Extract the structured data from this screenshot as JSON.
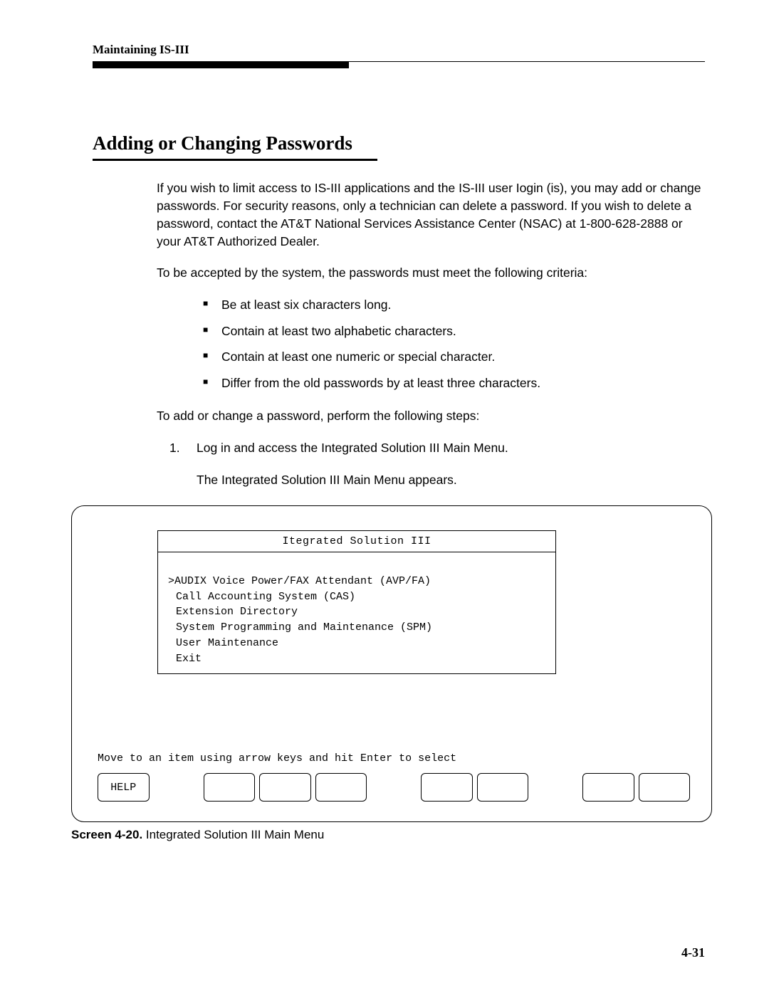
{
  "header": {
    "running_head": "Maintaining IS-III"
  },
  "section": {
    "title": "Adding or Changing Passwords",
    "para1": "If you wish to limit access to IS-III applications and the IS-III user Iogin (is), you may add or change passwords. For security reasons, only a technician can delete a password. If you wish to delete a password, contact the AT&T National Services Assistance Center (NSAC) at 1-800-628-2888 or your AT&T Authorized Dealer.",
    "para2": "To be accepted by the system, the passwords must meet the following criteria:",
    "bullets": [
      "Be at least six characters long.",
      "Contain at least two alphabetic characters.",
      "Contain at least one numeric or special character.",
      "Differ from the old passwords by at least three characters."
    ],
    "para3": "To add or change a password, perform the following steps:",
    "steps": [
      {
        "num": "1.",
        "text": "Log in and access the Integrated Solution III Main Menu."
      }
    ],
    "step_result": "The Integrated Solution III Main Menu appears."
  },
  "screen": {
    "menu_title": "Itegrated Solution III",
    "menu_items": [
      {
        "text": ">AUDIX Voice Power/FAX Attendant (AVP/FA)",
        "indent": false
      },
      {
        "text": "Call Accounting System (CAS)",
        "indent": true
      },
      {
        "text": "Extension Directory",
        "indent": true
      },
      {
        "text": "System Programming and Maintenance (SPM)",
        "indent": true
      },
      {
        "text": "User Maintenance",
        "indent": true
      },
      {
        "text": "Exit",
        "indent": true
      }
    ],
    "prompt": "Move to an item using arrow keys and hit Enter to select",
    "fkeys": [
      "HELP",
      "",
      "",
      "",
      "",
      "",
      "",
      ""
    ]
  },
  "caption": {
    "bold": "Screen 4-20.",
    "rest": " Integrated Solution III Main Menu"
  },
  "page_number": "4-31"
}
